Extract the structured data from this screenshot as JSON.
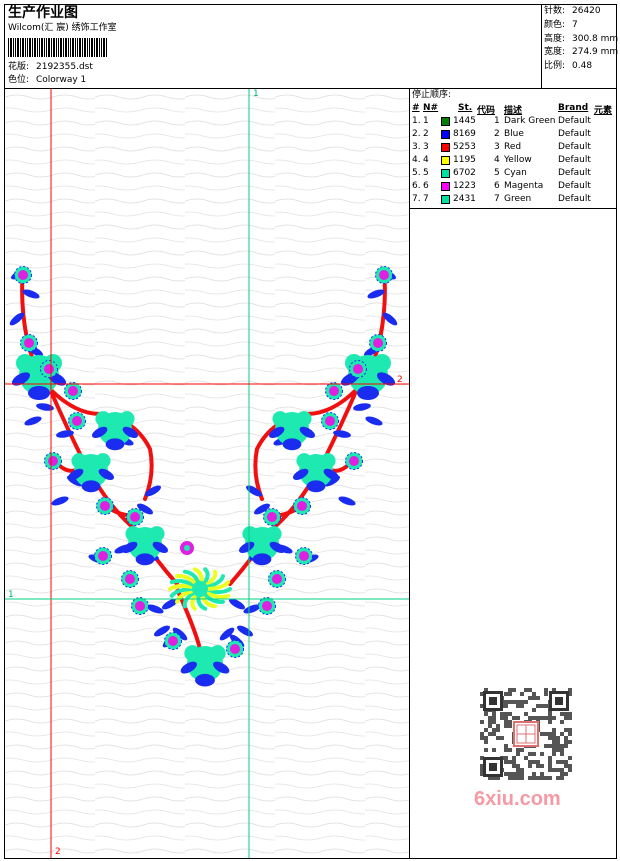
{
  "header": {
    "title": "生产作业图",
    "company": "Wilcom(汇 宸) 绣饰工作室",
    "design_label": "花版:",
    "design_file": "2192355.dst",
    "colorway_label": "色位:",
    "colorway": "Colorway 1"
  },
  "stats": {
    "stitches_label": "针数:",
    "stitches": "26420",
    "colors_label": "颜色:",
    "colors": "7",
    "height_label": "高度:",
    "height": "300.8 mm",
    "width_label": "宽度:",
    "width": "274.9 mm",
    "scale_label": "比例:",
    "scale": "0.48"
  },
  "stop_sequence": {
    "title": "停止顺序:",
    "columns": [
      "#",
      "N#",
      "St.",
      "代码",
      "描述",
      "Brand",
      "元素"
    ],
    "rows": [
      {
        "idx": "1.",
        "n": "1",
        "color": "#008000",
        "stitches": "1445",
        "code": "1",
        "desc": "Dark Green",
        "brand": "Default"
      },
      {
        "idx": "2.",
        "n": "2",
        "color": "#0000ff",
        "stitches": "8169",
        "code": "2",
        "desc": "Blue",
        "brand": "Default"
      },
      {
        "idx": "3.",
        "n": "3",
        "color": "#ff0000",
        "stitches": "5253",
        "code": "3",
        "desc": "Red",
        "brand": "Default"
      },
      {
        "idx": "4.",
        "n": "4",
        "color": "#ffff00",
        "stitches": "1195",
        "code": "4",
        "desc": "Yellow",
        "brand": "Default"
      },
      {
        "idx": "5.",
        "n": "5",
        "color": "#00e0a0",
        "stitches": "6702",
        "code": "5",
        "desc": "Cyan",
        "brand": "Default"
      },
      {
        "idx": "6.",
        "n": "6",
        "color": "#ff00ff",
        "stitches": "1223",
        "code": "6",
        "desc": "Magenta",
        "brand": "Default"
      },
      {
        "idx": "7.",
        "n": "7",
        "color": "#00e0a0",
        "stitches": "2431",
        "code": "7",
        "desc": "Green",
        "brand": "Default"
      }
    ]
  },
  "guides": {
    "v1": "1",
    "h2": "2",
    "h1": "1",
    "v2": "2"
  },
  "watermark": "6xiu.com",
  "colors": {
    "red_guide": "#ff0000",
    "green_guide": "#00d080",
    "petal": "#1de9b0",
    "leaf": "#1a2cf0",
    "stem": "#f01010",
    "bud": "#e020e0",
    "yellow": "#e8ff20"
  }
}
